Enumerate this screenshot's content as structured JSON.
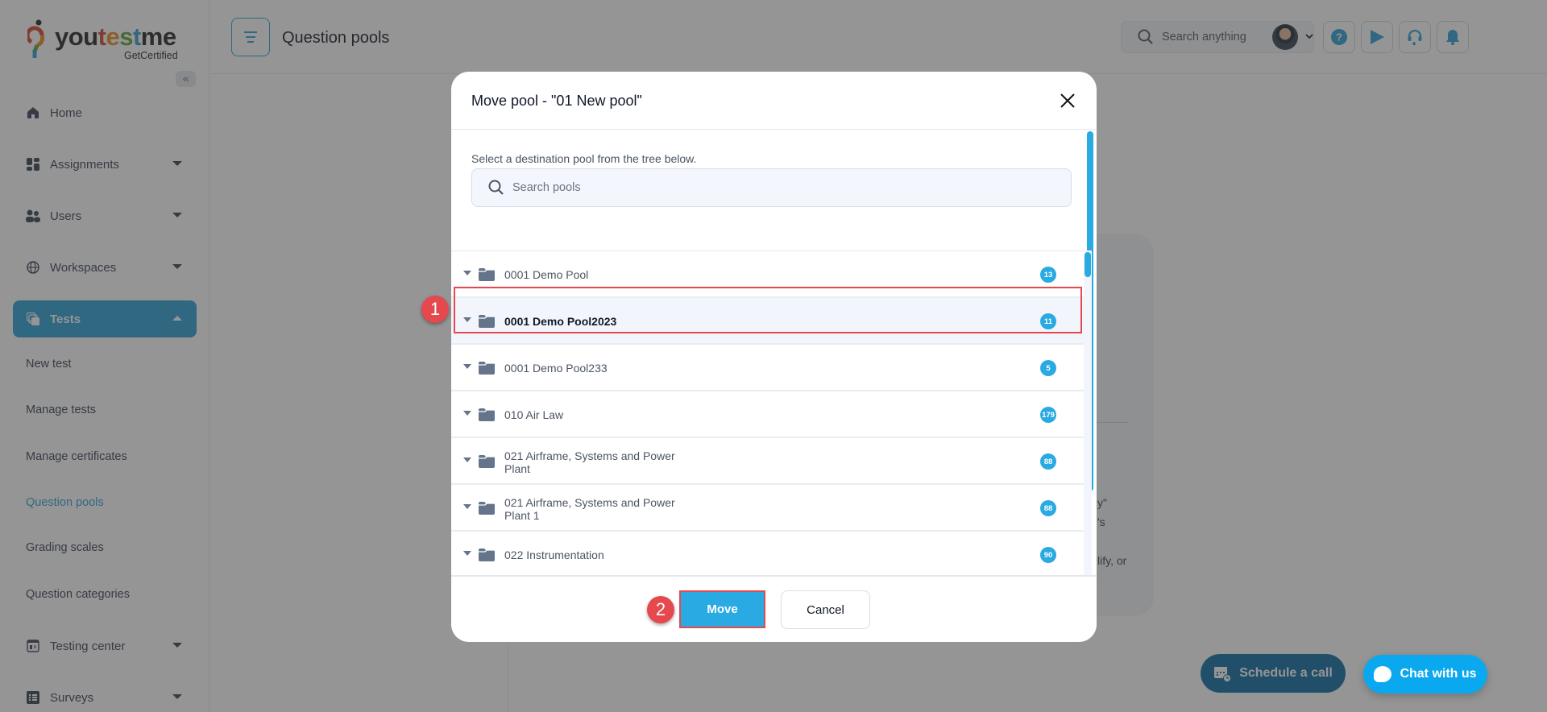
{
  "brand": {
    "logo_word_parts": [
      "you",
      "t",
      "e",
      "s",
      "t",
      "me"
    ],
    "logo_sub": "GetCertified",
    "colors": {
      "accent": "#2aaae2",
      "highlight": "#e5484d",
      "sidebar_active": "#2a9fd6"
    }
  },
  "sidebar": {
    "collapse_icon": "double-chevron-left-icon",
    "collapse_glyph": "«",
    "items": [
      {
        "label": "Home",
        "icon": "home-icon",
        "expandable": false
      },
      {
        "label": "Assignments",
        "icon": "dashboard-icon",
        "expandable": true
      },
      {
        "label": "Users",
        "icon": "users-icon",
        "expandable": true
      },
      {
        "label": "Workspaces",
        "icon": "globe-icon",
        "expandable": true
      },
      {
        "label": "Tests",
        "icon": "tests-icon",
        "expandable": true,
        "active": true
      },
      {
        "label": "Testing center",
        "icon": "testing-center-icon",
        "expandable": true
      },
      {
        "label": "Surveys",
        "icon": "surveys-icon",
        "expandable": true
      }
    ],
    "tests_subitems": [
      {
        "label": "New test"
      },
      {
        "label": "Manage tests"
      },
      {
        "label": "Manage certificates"
      },
      {
        "label": "Question pools",
        "current": true
      },
      {
        "label": "Grading scales"
      },
      {
        "label": "Question categories"
      }
    ]
  },
  "header": {
    "title": "Question pools",
    "search_placeholder": "Search anything",
    "icons": [
      "help-icon",
      "play-icon",
      "support-headset-icon",
      "bell-icon"
    ]
  },
  "background_card": {
    "fragments": [
      "y\"",
      "'s",
      "lify, or"
    ]
  },
  "modal": {
    "title": "Move pool - \"01 New pool\"",
    "intro": "Select a destination pool from the tree below.",
    "search_placeholder": "Search pools",
    "pools": [
      {
        "name": "0001 Demo Pool",
        "count": "13",
        "selected": false
      },
      {
        "name": "0001 Demo Pool2023",
        "count": "11",
        "selected": true
      },
      {
        "name": "0001 Demo Pool233",
        "count": "5",
        "selected": false
      },
      {
        "name": "010 Air Law",
        "count": "179",
        "selected": false
      },
      {
        "name": "021 Airframe, Systems and Power Plant",
        "count": "88",
        "selected": false
      },
      {
        "name": "021 Airframe, Systems and Power Plant 1",
        "count": "88",
        "selected": false
      },
      {
        "name": "022 Instrumentation",
        "count": "90",
        "selected": false
      }
    ],
    "move_label": "Move",
    "cancel_label": "Cancel"
  },
  "annotations": {
    "step1": "1",
    "step2": "2"
  },
  "floating": {
    "schedule_label": "Schedule a call",
    "chat_label": "Chat with us"
  }
}
